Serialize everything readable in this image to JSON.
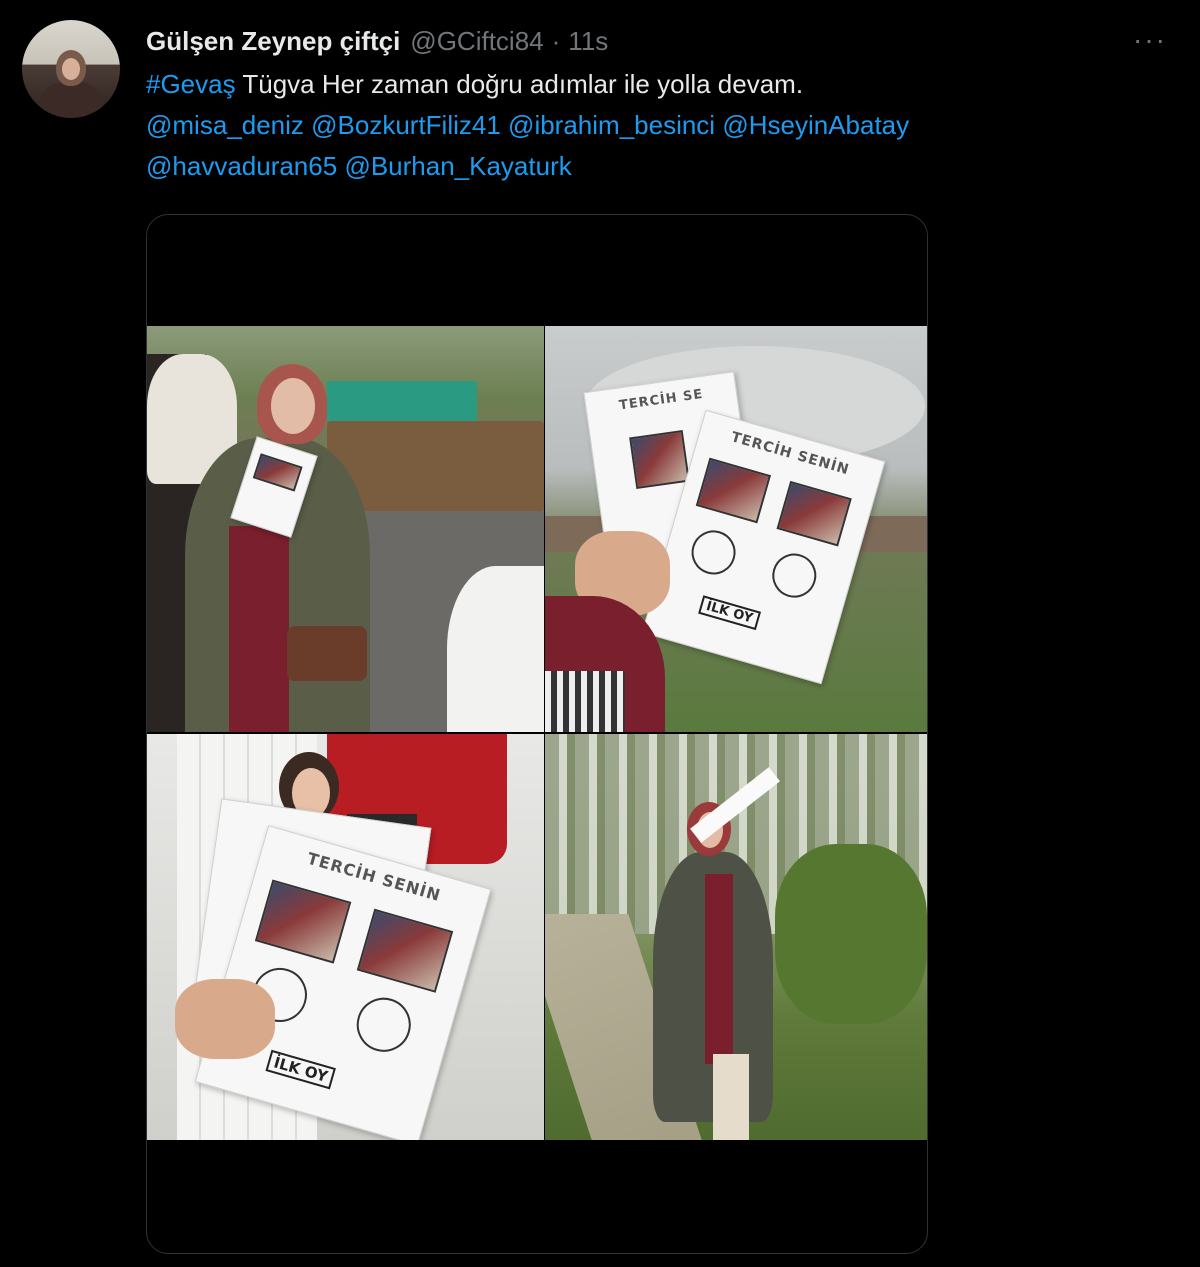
{
  "tweet": {
    "author": {
      "display_name": "Gülşen Zeynep çiftçi",
      "handle": "@GCiftci84",
      "separator": "·",
      "time": "11s",
      "avatar_icon": "user-avatar"
    },
    "more_label": "···",
    "text": {
      "hashtag": "#Gevaş",
      "body": " Tügva Her zaman doğru adımlar ile yolla devam.",
      "mentions": [
        "@misa_deniz",
        "@BozkurtFiliz41",
        "@ibrahim_besinci",
        "@HseyinAbatay",
        "@havvaduran65",
        "@Burhan_Kayaturk"
      ]
    },
    "media": {
      "photos": [
        {
          "alt": "photo-1",
          "ballot_title": "",
          "logo": ""
        },
        {
          "alt": "photo-2",
          "ballot_title_back": "TERCİH SE",
          "ballot_title": "TERCİH SENİN",
          "logo": "İLK OY"
        },
        {
          "alt": "photo-3",
          "ballot_title": "TERCİH SENİN",
          "logo": "İLK OY"
        },
        {
          "alt": "photo-4",
          "ballot_title": "",
          "logo": ""
        }
      ]
    }
  },
  "colors": {
    "background": "#000000",
    "text": "#e7e9ea",
    "secondary": "#71767b",
    "link": "#1d9bf0",
    "border": "#2f3336"
  }
}
